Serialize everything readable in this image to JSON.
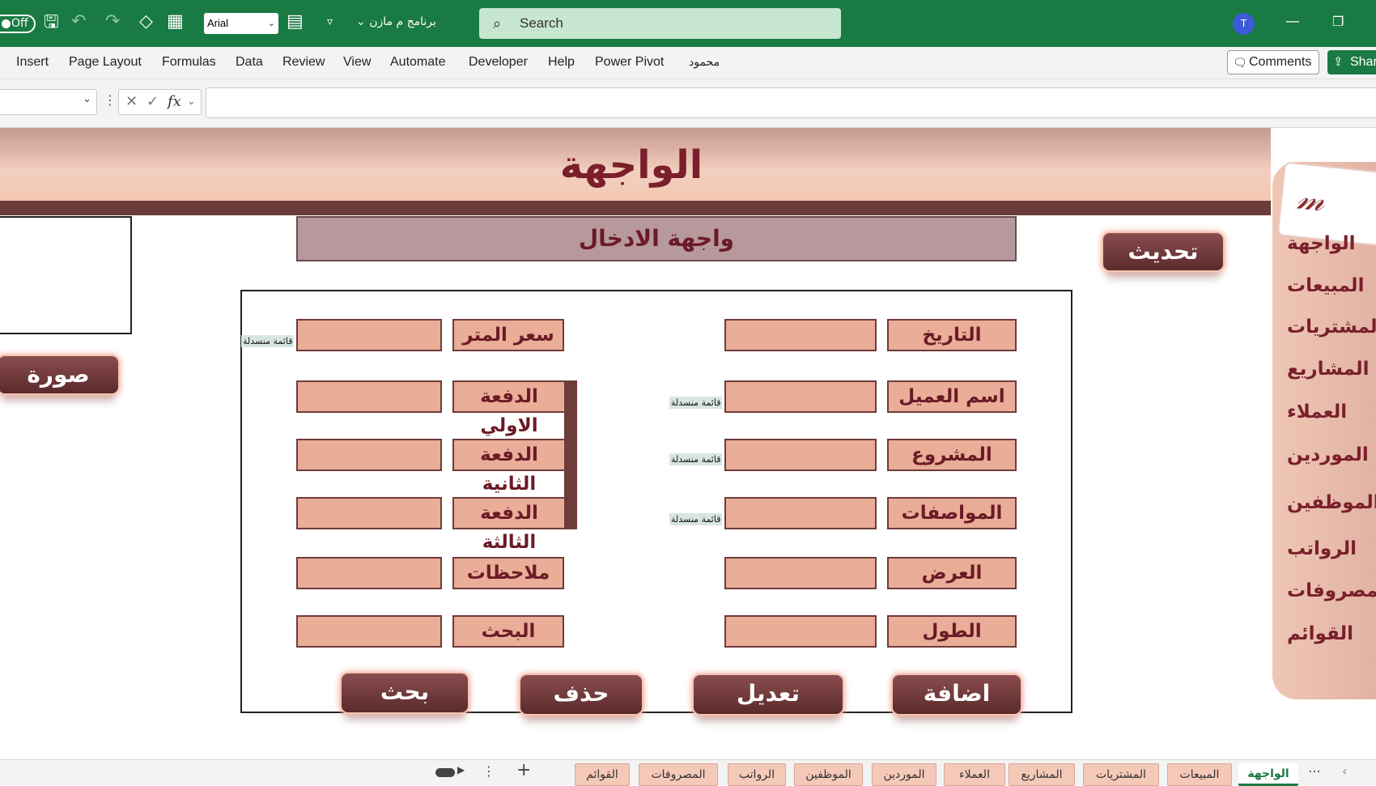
{
  "titlebar": {
    "autosave": "Off",
    "font_name": "Arial",
    "program_name": "برنامج م مازن",
    "search_placeholder": "Search",
    "avatar_letter": "T",
    "colors": {
      "bar": "#1a7a43"
    }
  },
  "ribbon": {
    "tabs": [
      "Insert",
      "Page Layout",
      "Formulas",
      "Data",
      "Review",
      "View",
      "Automate",
      "Developer",
      "Help",
      "Power Pivot",
      "محمود"
    ],
    "comments": "Comments",
    "share": "Shar"
  },
  "formula_bar": {
    "fx": "fx",
    "name": "",
    "formula": ""
  },
  "sheet": {
    "banner_title": "الواجهة",
    "entry_header": "واجهة الادخال",
    "refresh_button": "تحديث",
    "photo_button": "صورة",
    "dropdown_hint": "قائمة منسدلة",
    "right_labels": [
      "التاريخ",
      "اسم العميل",
      "المشروع",
      "المواصفات",
      "العرض",
      "الطول"
    ],
    "left_labels": [
      "سعر المتر",
      "الدفعة الاولي",
      "الدفعة الثانية",
      "الدفعة الثالثة",
      "ملاحظات",
      "البحث"
    ],
    "action_buttons": {
      "add": "اضافة",
      "edit": "تعديل",
      "delete": "حذف",
      "search": "بحث"
    },
    "colors": {
      "label_fill": "#e9ad98",
      "label_text": "#6b1a26",
      "button": "#6e3c3a"
    }
  },
  "nav": {
    "logo_text": "مازن",
    "items": [
      "الواجهة",
      "المبيعات",
      "المشتريات",
      "المشاريع",
      "العملاء",
      "الموردين",
      "الموظفين",
      "الرواتب",
      "المصروفات",
      "القوائم"
    ]
  },
  "sheet_tabs": {
    "tabs": [
      "الواجهة",
      "المبيعات",
      "المشتريات",
      "المشاريع",
      "العملاء",
      "الموردين",
      "الموظفين",
      "الرواتب",
      "المصروفات",
      "القوائم"
    ],
    "active": "الواجهة",
    "add": "+",
    "more": "⋯"
  }
}
